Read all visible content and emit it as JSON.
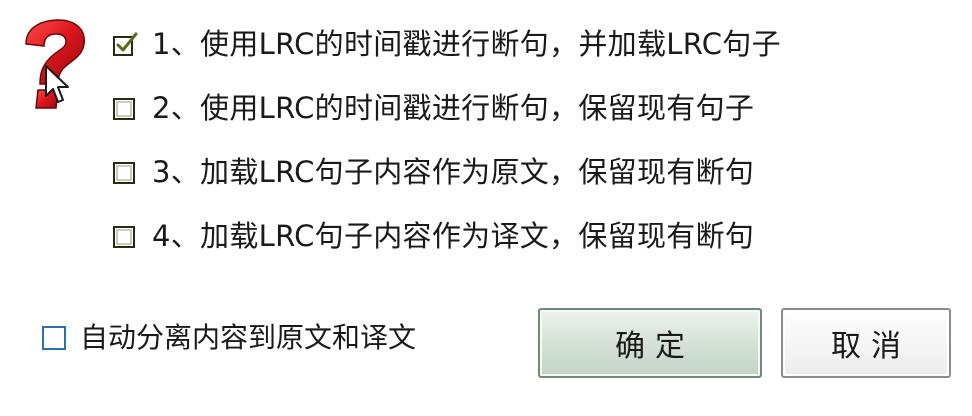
{
  "options": [
    {
      "label": "1、使用LRC的时间戳进行断句，并加载LRC句子",
      "checked": true
    },
    {
      "label": "2、使用LRC的时间戳进行断句，保留现有句子",
      "checked": false
    },
    {
      "label": "3、加载LRC句子内容作为原文，保留现有断句",
      "checked": false
    },
    {
      "label": "4、加载LRC句子内容作为译文，保留现有断句",
      "checked": false
    }
  ],
  "auto_split": {
    "label": "自动分离内容到原文和译文",
    "checked": false
  },
  "buttons": {
    "ok_label": "确定",
    "cancel_label": "取消"
  },
  "icons": {
    "prompt": "question-mark-icon",
    "cursor": "mouse-cursor-icon"
  },
  "colors": {
    "question_mark": "#d9141b",
    "checkbox_border": "#2a2a10",
    "auto_checkbox_border": "#2a6fb8",
    "ok_button_fill": "#d3e0d6"
  }
}
